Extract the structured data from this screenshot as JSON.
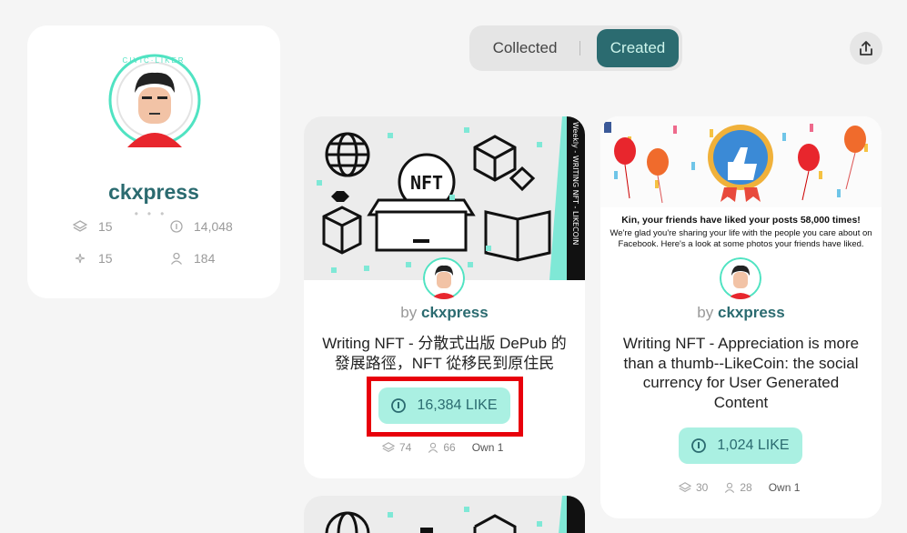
{
  "profile": {
    "username": "ckxpress",
    "badge_text": "CIVIC·LIKER",
    "stats": {
      "collected_classes": "15",
      "likes": "14,048",
      "created": "15",
      "supporters": "184"
    }
  },
  "tabs": {
    "collected": "Collected",
    "created": "Created",
    "active": "Created"
  },
  "cards": [
    {
      "by": "by",
      "author": "ckxpress",
      "title": "Writing NFT - 分散式出版 DePub 的發展路徑，NFT 從移民到原住民",
      "like_label": "16,384 LIKE",
      "collections": "74",
      "owners": "66",
      "own": "Own 1",
      "image_text": "NFT",
      "side_text": "Weekly - WRITING NFT - LIKECOIN"
    },
    {
      "by": "by",
      "author": "ckxpress",
      "title": "Writing NFT - Appreciation is more than a thumb--LikeCoin: the social currency for User Generated Content",
      "like_label": "1,024 LIKE",
      "collections": "30",
      "owners": "28",
      "own": "Own 1",
      "image_headline": "Kin, your friends have liked your posts 58,000 times!",
      "image_body": "We're glad you're sharing your life with the people you care about on Facebook. Here's a look at some photos your friends have liked."
    }
  ],
  "colors": {
    "brand": "#2b6b70",
    "like_bg": "#aaf0e2",
    "highlight": "#e8000b"
  }
}
